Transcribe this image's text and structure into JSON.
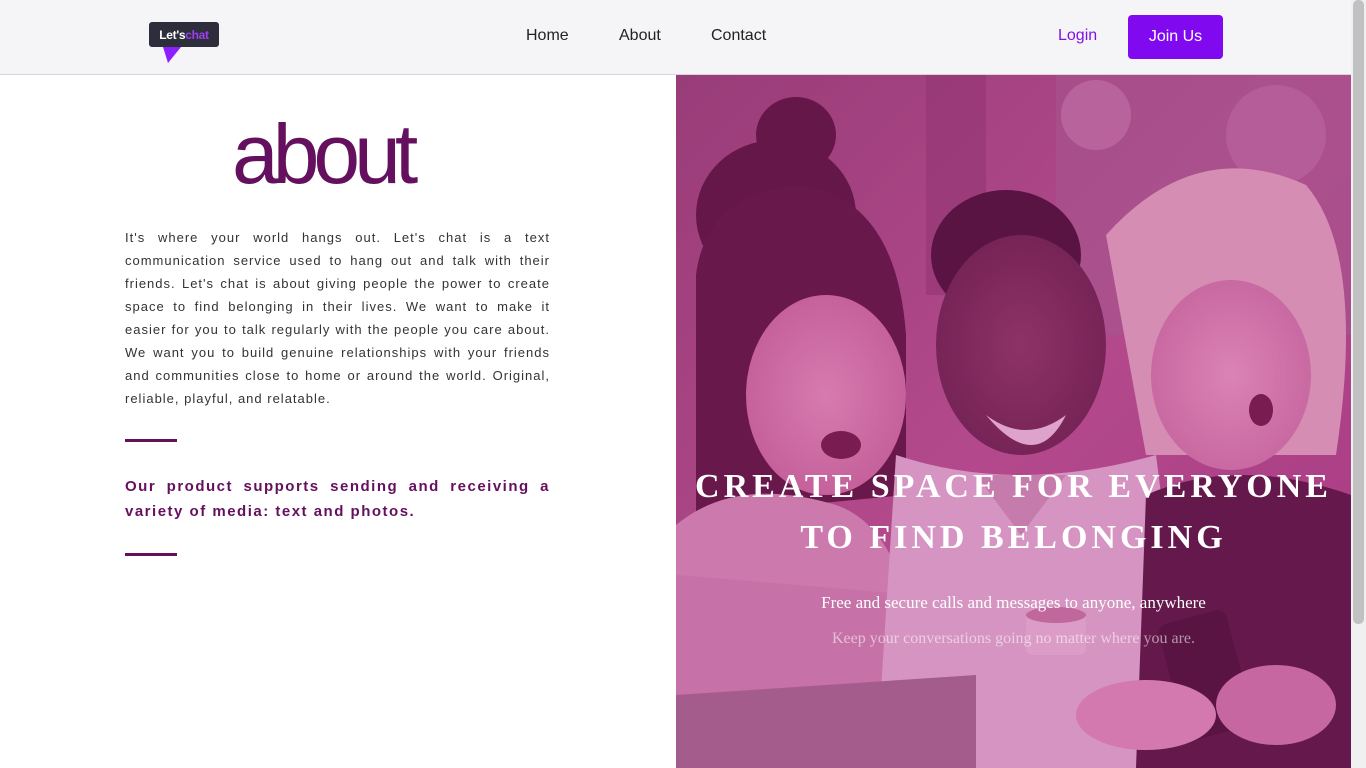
{
  "colors": {
    "accent": "#8109f0",
    "brand_dark": "#64105e",
    "nav_bg": "#f5f5f7",
    "hero_overlay": "#b4248c"
  },
  "nav": {
    "logo_text_a": "Let's",
    "logo_text_b": "chat",
    "links": [
      "Home",
      "About",
      "Contact"
    ],
    "login_label": "Login",
    "join_label": "Join Us"
  },
  "about": {
    "title": "about",
    "body": "It's where your world hangs out. Let's chat is a text communication service used to hang out and talk with their friends. Let's chat is about giving people the power to create space to find belonging in their lives. We want to make it easier for you to talk regularly with the people you care about. We want you to build genuine relationships with your friends and communities close to home or around the world. Original, reliable, playful, and relatable.",
    "product": "Our product supports sending and receiving a variety of media: text and photos."
  },
  "hero": {
    "title": "CREATE SPACE FOR EVERYONE TO FIND BELONGING",
    "subtitle": "Free and secure calls and messages to anyone, anywhere",
    "subtitle2": "Keep your conversations going no matter where you are.",
    "image_icon": "three-friends-looking-at-phone-photo"
  }
}
